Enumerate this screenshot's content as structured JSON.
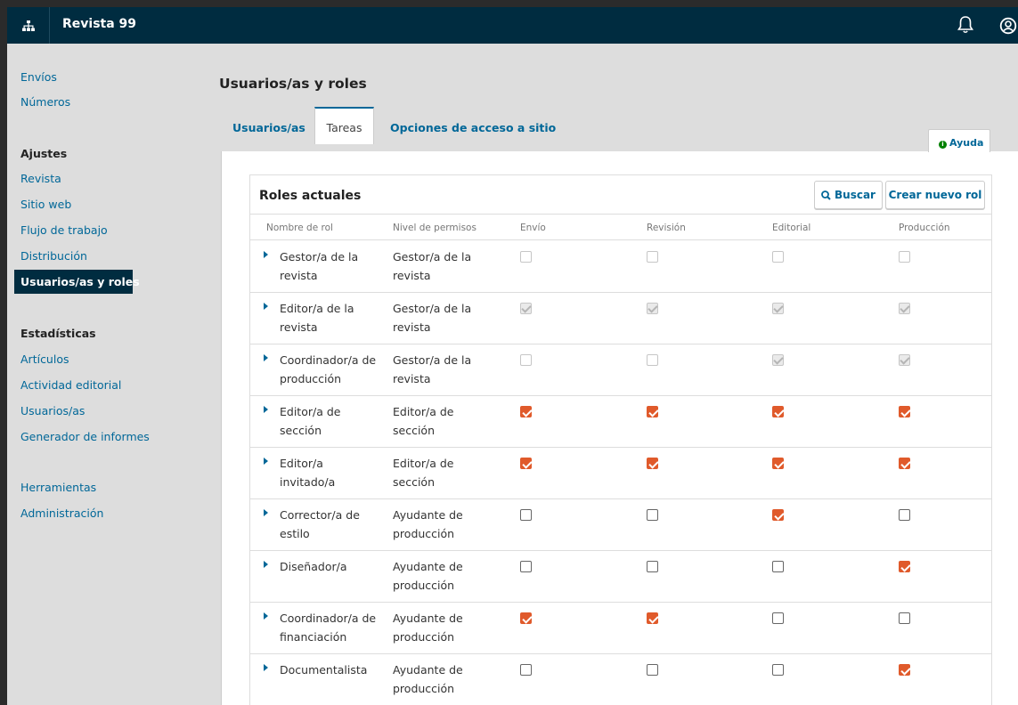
{
  "header": {
    "title": "Revista 99"
  },
  "sidebar": {
    "top_items": [
      "Envíos",
      "Números"
    ],
    "settings_heading": "Ajustes",
    "settings_items": [
      "Revista",
      "Sitio web",
      "Flujo de trabajo",
      "Distribución"
    ],
    "active_item": "Usuarios/as y roles",
    "stats_heading": "Estadísticas",
    "stats_items": [
      "Artículos",
      "Actividad editorial",
      "Usuarios/as",
      "Generador de informes"
    ],
    "bottom_items": [
      "Herramientas",
      "Administración"
    ]
  },
  "page": {
    "title": "Usuarios/as y roles",
    "tabs": [
      "Usuarios/as",
      "Tareas",
      "Opciones de acceso a sitio"
    ],
    "active_tab": "Tareas",
    "help_label": "Ayuda"
  },
  "grid": {
    "title": "Roles actuales",
    "search_label": "Buscar",
    "create_label": "Crear nuevo rol",
    "columns": [
      "Nombre de rol",
      "Nivel de permisos",
      "Envío",
      "Revisión",
      "Editorial",
      "Producción"
    ],
    "rows": [
      {
        "name": "Gestor/a de la revista",
        "level": "Gestor/a de la revista",
        "checks": [
          "off-dis",
          "off-dis",
          "off-dis",
          "off-dis"
        ]
      },
      {
        "name": "Editor/a de la revista",
        "level": "Gestor/a de la revista",
        "checks": [
          "on-dis",
          "on-dis",
          "on-dis",
          "on-dis"
        ]
      },
      {
        "name": "Coordinador/a de producción",
        "level": "Gestor/a de la revista",
        "checks": [
          "off-dis",
          "off-dis",
          "on-dis",
          "on-dis"
        ]
      },
      {
        "name": "Editor/a de sección",
        "level": "Editor/a de sección",
        "checks": [
          "on",
          "on",
          "on",
          "on"
        ]
      },
      {
        "name": "Editor/a invitado/a",
        "level": "Editor/a de sección",
        "checks": [
          "on",
          "on",
          "on",
          "on"
        ]
      },
      {
        "name": "Corrector/a de estilo",
        "level": "Ayudante de producción",
        "checks": [
          "off",
          "off",
          "on",
          "off"
        ]
      },
      {
        "name": "Diseñador/a",
        "level": "Ayudante de producción",
        "checks": [
          "off",
          "off",
          "off",
          "on"
        ]
      },
      {
        "name": "Coordinador/a de financiación",
        "level": "Ayudante de producción",
        "checks": [
          "on",
          "on",
          "off",
          "off"
        ]
      },
      {
        "name": "Documentalista",
        "level": "Ayudante de producción",
        "checks": [
          "off",
          "off",
          "off",
          "on"
        ]
      }
    ]
  },
  "colors": {
    "header_bg": "#002c40",
    "link": "#006798",
    "checked": "#e05a2b"
  }
}
